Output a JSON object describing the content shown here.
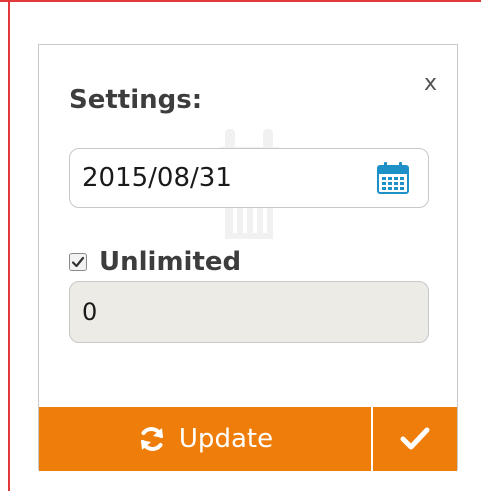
{
  "dialog": {
    "title": "Settings:",
    "close_label": "x"
  },
  "date_field": {
    "value": "2015/08/31",
    "icon": "calendar-icon"
  },
  "unlimited": {
    "label": "Unlimited",
    "checked": true
  },
  "quantity_field": {
    "value": "0",
    "disabled": true
  },
  "footer": {
    "update_label": "Update",
    "update_icon": "refresh-icon",
    "confirm_icon": "checkmark-icon"
  },
  "colors": {
    "accent": "#ef7d0a",
    "calendar_icon": "#1e90c8",
    "frame": "#e23a3a",
    "disabled_field": "#ecebe6"
  }
}
